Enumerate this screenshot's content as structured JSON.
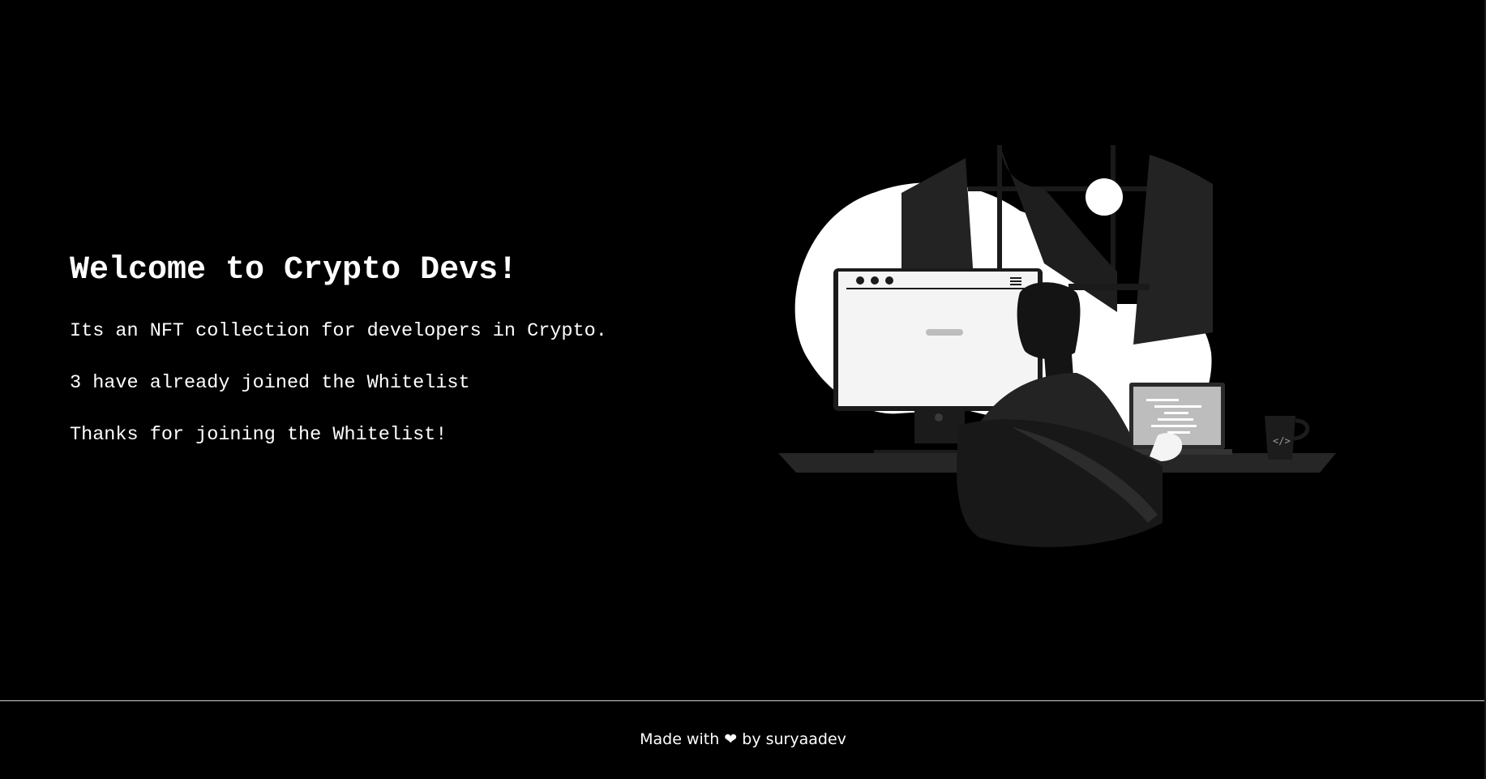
{
  "hero": {
    "title": "Welcome to Crypto Devs!",
    "description": "Its an NFT collection for developers in Crypto.",
    "joined_count_text": "3 have already joined the Whitelist",
    "status_text": "Thanks for joining the Whitelist!"
  },
  "illustration": {
    "icon": "developer-at-desk-illustration",
    "colors": {
      "blob": "#ffffff",
      "dark": "#222222",
      "darker": "#141414",
      "screen": "#f4f4f4",
      "laptop_screen": "#bdbdbd"
    }
  },
  "footer": {
    "prefix": "Made with",
    "heart": "❤",
    "suffix": "by suryaadev"
  }
}
